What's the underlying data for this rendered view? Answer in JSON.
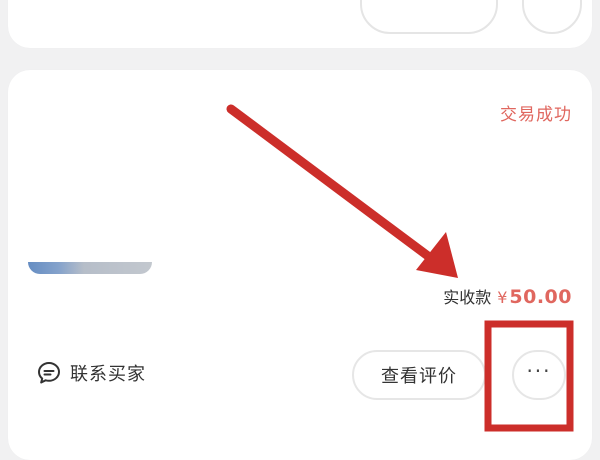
{
  "order": {
    "status": "交易成功",
    "amount_label": "实收款",
    "currency": "¥",
    "amount": "50.00"
  },
  "actions": {
    "contact_label": "联系买家",
    "review_label": "查看评价",
    "more_label": "···"
  },
  "icons": {
    "contact": "chat-bubble-icon",
    "more": "more-dots-icon"
  },
  "colors": {
    "status": "#e0675f",
    "annotation": "#cc2e2a"
  }
}
